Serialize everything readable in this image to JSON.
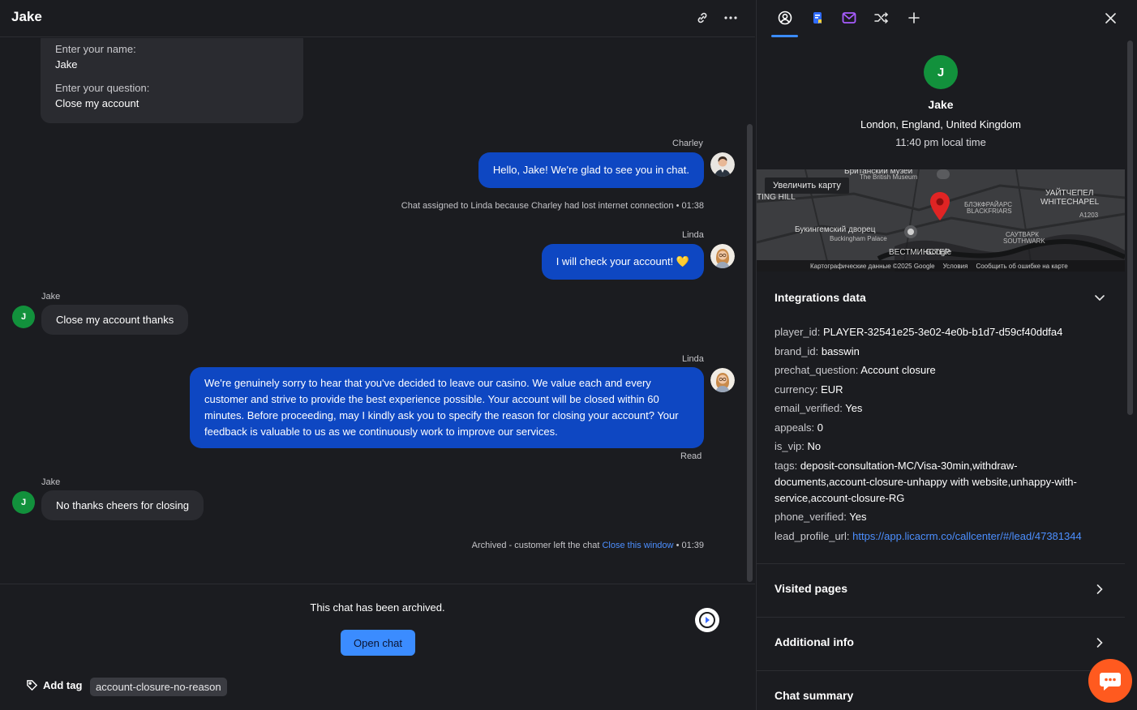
{
  "chat": {
    "title": "Jake",
    "prechat": {
      "name_label": "Enter your name:",
      "name_value": "Jake",
      "question_label": "Enter your question:",
      "question_value": "Close my account"
    },
    "messages": [
      {
        "sender": "Charley",
        "text": "Hello, Jake! We're glad to see you in chat."
      },
      {
        "system": "Chat assigned to Linda because Charley had lost internet connection",
        "time": "• 01:38"
      },
      {
        "sender": "Linda",
        "text": "I will check your account! 💛"
      },
      {
        "sender": "Jake",
        "avatar": "J",
        "text": "Close my account thanks"
      },
      {
        "sender": "Linda",
        "text": "We're genuinely sorry to hear that you've decided to leave our casino. We value each and every customer and strive to provide the best experience possible. Your account will be closed within 60 minutes. Before proceeding, may I kindly ask you to specify the reason for closing your account? Your feedback is valuable to us as we continuously work to improve our services.",
        "status": "Read"
      },
      {
        "sender": "Jake",
        "avatar": "J",
        "text": "No thanks cheers for closing"
      },
      {
        "system": "Archived - customer left the chat",
        "link": "Close this window",
        "time": "• 01:39"
      }
    ],
    "composer": {
      "archived_text": "This chat has been archived.",
      "open_chat_label": "Open chat",
      "add_tag_label": "Add tag",
      "tag": "account-closure-no-reason"
    }
  },
  "details": {
    "tabs": [
      "customer-icon",
      "book-icon",
      "mail-icon",
      "shuffle-icon",
      "plus-icon"
    ],
    "customer": {
      "avatar": "J",
      "name": "Jake",
      "location": "London, England, United Kingdom",
      "local_time": "11:40 pm local time"
    },
    "map": {
      "enlarge_label": "Увеличить карту",
      "labels": {
        "museum": "Британский музей",
        "museum_en": "The British Museum",
        "ting_hill": "TING HILL",
        "blackfriars_ru": "БЛЭКФРАЙАРС",
        "blackfriars_en": "BLACKFRIARS",
        "whitechapel_ru": "УАЙТЧЕПЕЛ",
        "whitechapel_en": "WHITECHAPEL",
        "road": "A1203",
        "palace_ru": "Букингемский дворец",
        "palace_en": "Buckingham Palace",
        "southwark_ru": "САУТВАРК",
        "southwark_en": "SOUTHWARK",
        "westminster": "ВЕСТМИНСТЕР",
        "google": "Google"
      },
      "footer_data": "Картографические данные ©2025 Google",
      "footer_terms": "Условия",
      "footer_report": "Сообщить об ошибке на карте"
    },
    "integrations": {
      "title": "Integrations data",
      "rows": [
        {
          "key": "player_id:",
          "value": "PLAYER-32541e25-3e02-4e0b-b1d7-d59cf40ddfa4"
        },
        {
          "key": "brand_id:",
          "value": "basswin"
        },
        {
          "key": "prechat_question:",
          "value": "Account closure"
        },
        {
          "key": "currency:",
          "value": "EUR"
        },
        {
          "key": "email_verified:",
          "value": "Yes"
        },
        {
          "key": "appeals:",
          "value": "0"
        },
        {
          "key": "is_vip:",
          "value": "No"
        },
        {
          "key": "tags:",
          "value": "deposit-consultation-MC/Visa-30min,withdraw-documents,account-closure-unhappy with website,unhappy-with-service,account-closure-RG"
        },
        {
          "key": "phone_verified:",
          "value": "Yes"
        },
        {
          "key": "lead_profile_url:",
          "value": "https://app.licacrm.co/callcenter/#/lead/47381344"
        }
      ]
    },
    "sections": {
      "visited_pages": "Visited pages",
      "additional_info": "Additional info",
      "chat_summary": "Chat summary"
    }
  },
  "colors": {
    "agent_bubble": "#0e47c2",
    "customer_avatar": "#12913c",
    "accent": "#3b8cff",
    "widget": "#ff5a1f"
  }
}
